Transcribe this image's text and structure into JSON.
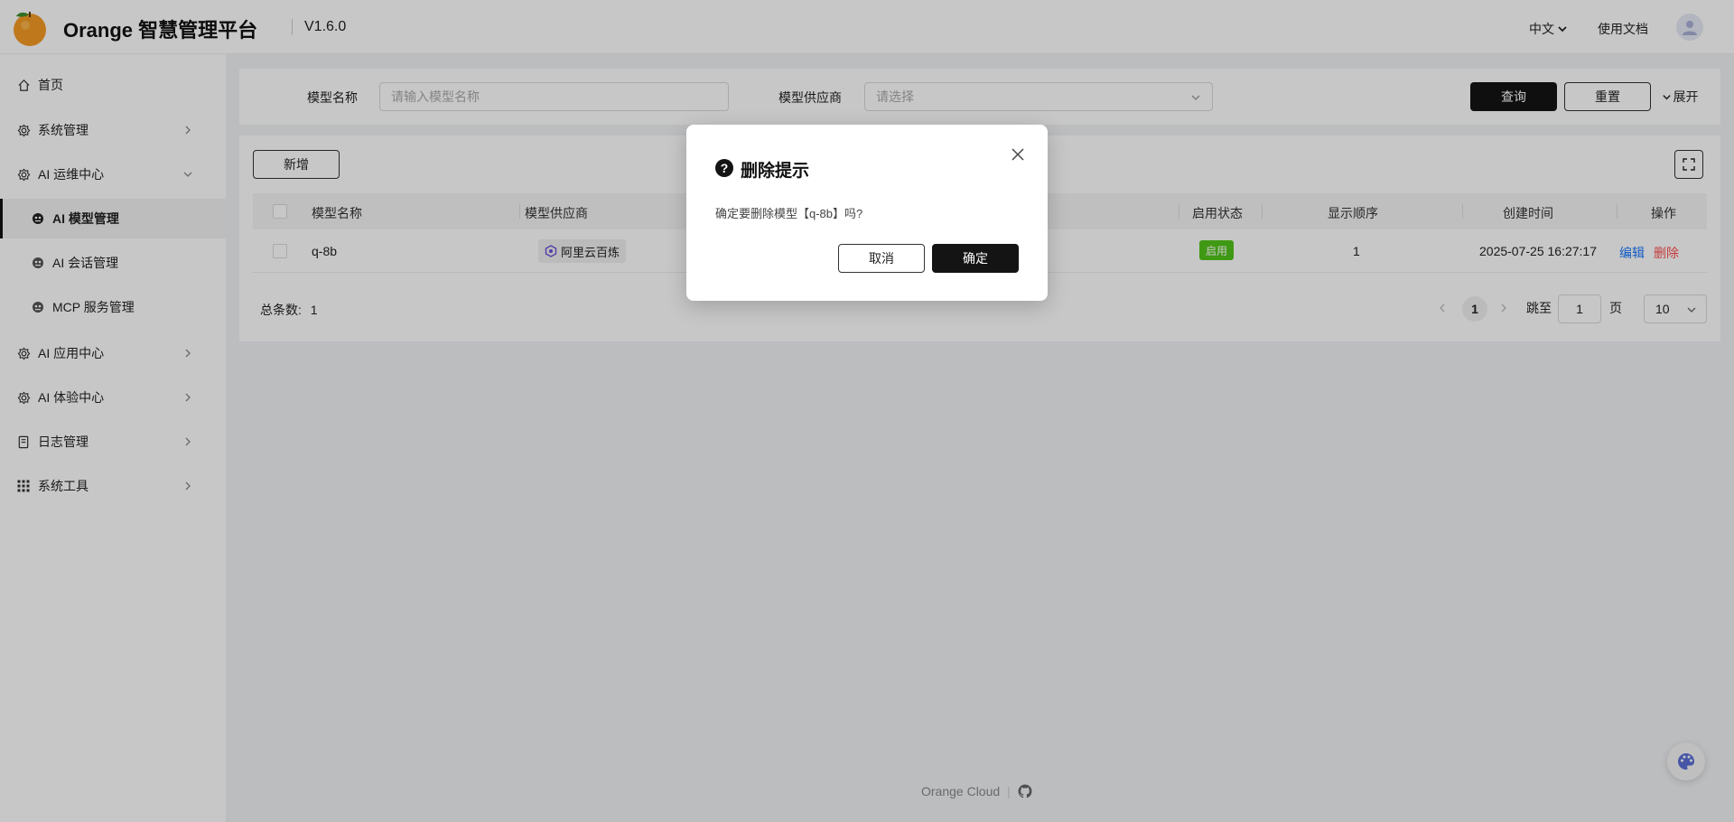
{
  "header": {
    "app_title": "Orange 智慧管理平台",
    "version": "V1.6.0",
    "language": "中文",
    "docs": "使用文档"
  },
  "sidebar": {
    "items": [
      {
        "label": "首页",
        "icon": "home-icon"
      },
      {
        "label": "系统管理",
        "icon": "gear-icon"
      },
      {
        "label": "AI 运维中心",
        "icon": "gear-icon"
      },
      {
        "label": "AI 模型管理",
        "icon": "robot-icon",
        "active": true
      },
      {
        "label": "AI 会话管理",
        "icon": "robot-icon"
      },
      {
        "label": "MCP 服务管理",
        "icon": "robot-icon"
      },
      {
        "label": "AI 应用中心",
        "icon": "gear-icon"
      },
      {
        "label": "AI 体验中心",
        "icon": "gear-icon"
      },
      {
        "label": "日志管理",
        "icon": "document-icon"
      },
      {
        "label": "系统工具",
        "icon": "grid-icon"
      }
    ]
  },
  "search": {
    "name_label": "模型名称",
    "name_placeholder": "请输入模型名称",
    "provider_label": "模型供应商",
    "provider_placeholder": "请选择",
    "query_btn": "查询",
    "reset_btn": "重置",
    "expand": "展开"
  },
  "table": {
    "add_btn": "新增",
    "columns": [
      "模型名称",
      "模型供应商",
      "启用状态",
      "显示顺序",
      "创建时间",
      "操作"
    ],
    "rows": [
      {
        "name": "q-8b",
        "provider": "阿里云百炼",
        "status": "启用",
        "order": "1",
        "created": "2025-07-25 16:27:17",
        "edit": "编辑",
        "delete": "删除"
      }
    ]
  },
  "pagination": {
    "total_label": "总条数:",
    "total": "1",
    "current_page": "1",
    "jump_label": "跳至",
    "jump_value": "1",
    "page_unit": "页",
    "page_size": "10"
  },
  "footer": {
    "text": "Orange Cloud"
  },
  "dialog": {
    "title": "删除提示",
    "message": "确定要删除模型【q-8b】吗?",
    "cancel": "取消",
    "confirm": "确定"
  },
  "colors": {
    "accent": "#141414",
    "success": "#52c41a",
    "link": "#1677ff",
    "danger": "#ff4d4f"
  }
}
